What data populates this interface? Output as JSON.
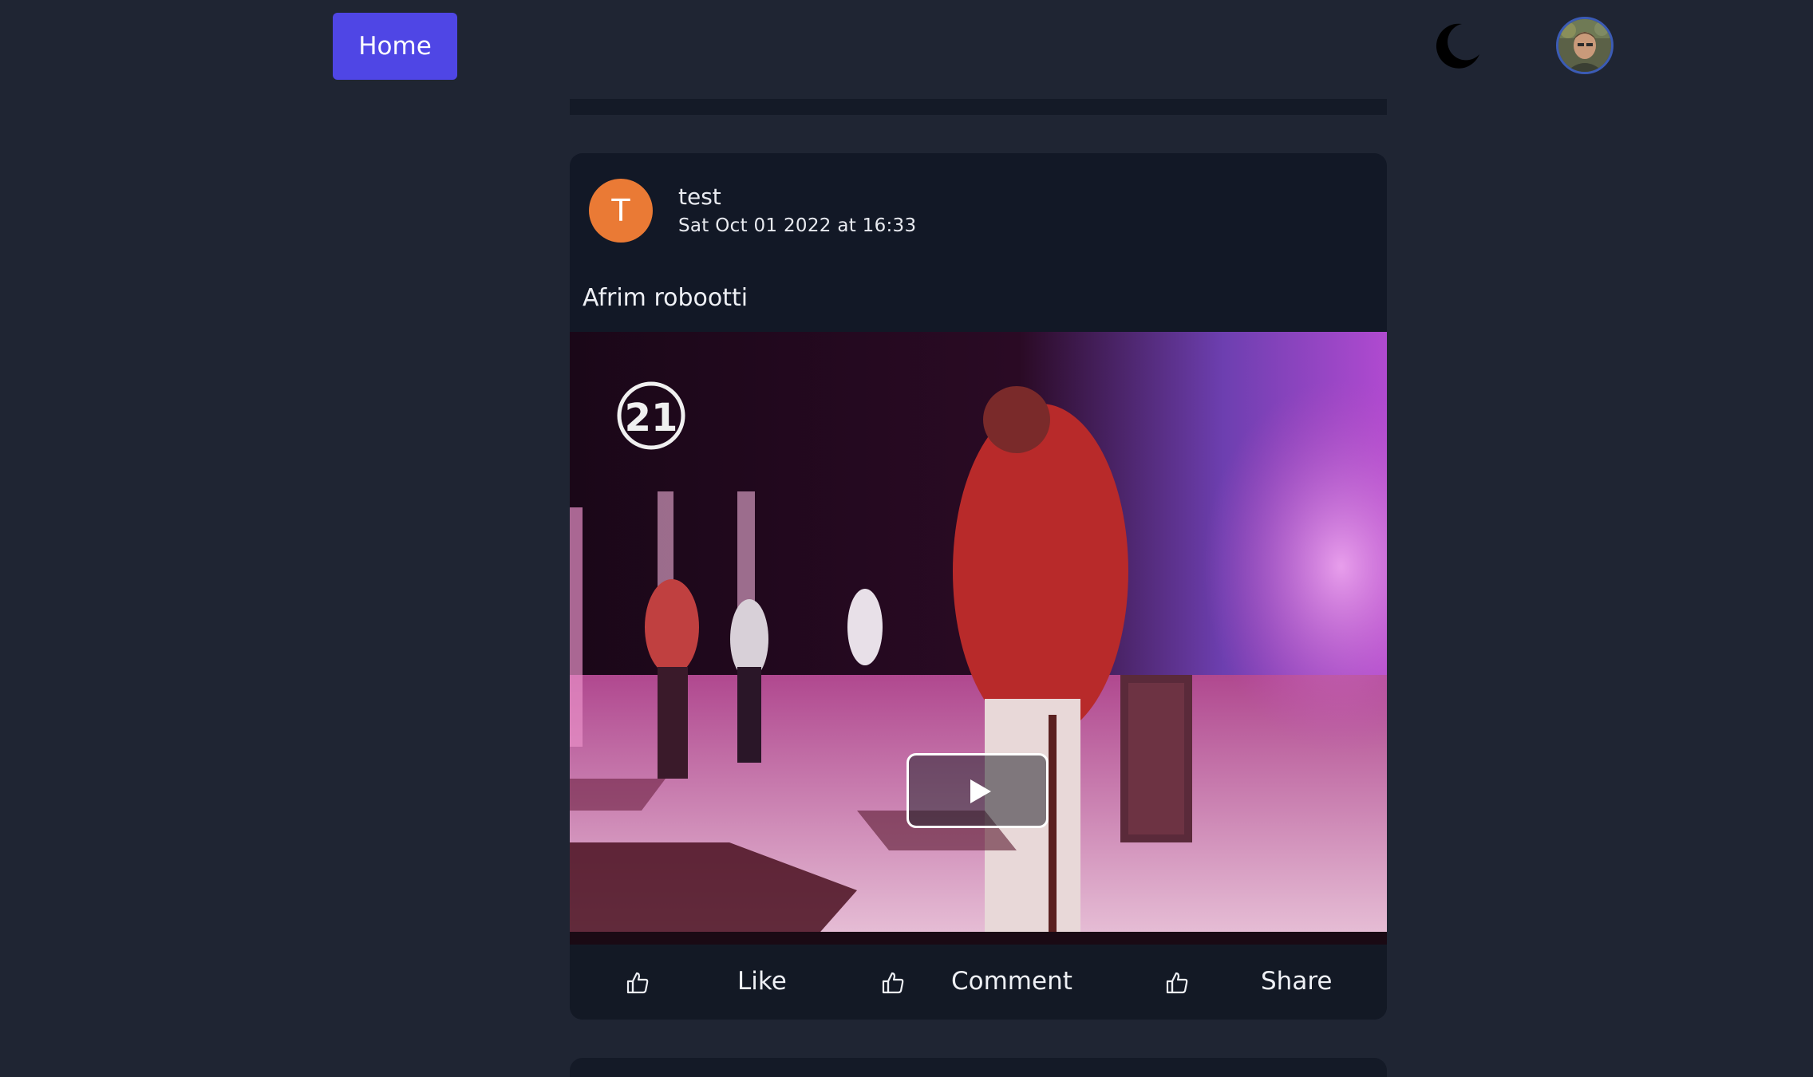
{
  "nav": {
    "home_label": "Home",
    "theme_icon": "moon-icon",
    "profile_avatar": "user-avatar"
  },
  "post": {
    "author_initial": "T",
    "author_name": "test",
    "date": "Sat Oct 01 2022 at 16:33",
    "text": "Afrim robootti",
    "video": {
      "overlay_logo": "21",
      "play_icon": "play-icon"
    },
    "actions": {
      "like_label": "Like",
      "comment_label": "Comment",
      "share_label": "Share",
      "icon": "thumbs-up-icon"
    }
  },
  "colors": {
    "background": "#1f2533",
    "card": "#121826",
    "accent": "#4f46e5",
    "author_avatar": "#ea7a35"
  }
}
